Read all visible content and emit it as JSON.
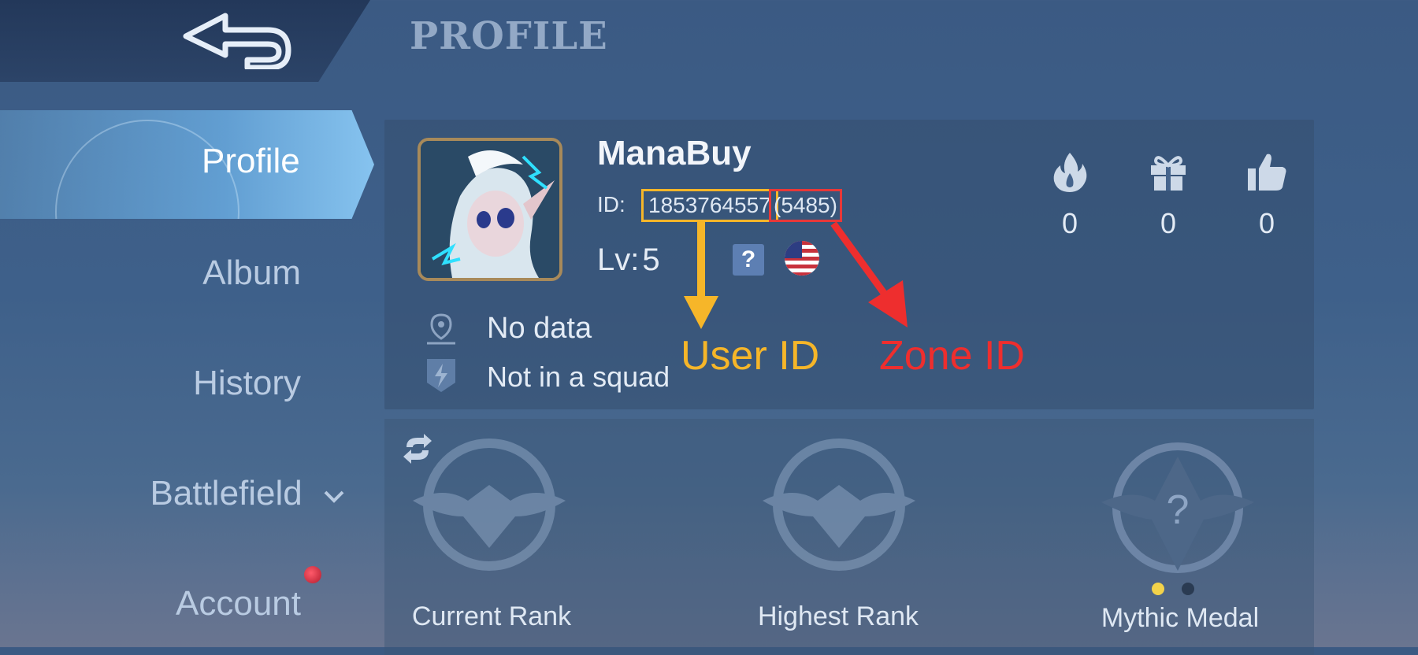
{
  "header": {
    "title": "PROFILE",
    "back_icon": "back-arrow-icon"
  },
  "sidebar": {
    "items": [
      {
        "label": "Profile",
        "active": true
      },
      {
        "label": "Album"
      },
      {
        "label": "History"
      },
      {
        "label": "Battlefield"
      },
      {
        "label": "Account",
        "has_notification": true
      }
    ]
  },
  "profile": {
    "username": "ManaBuy",
    "id_label": "ID:",
    "user_id": "1853764557",
    "zone_id": "(5485)",
    "level_label": "Lv:",
    "level": "5",
    "help_glyph": "?",
    "location": "No data",
    "squad": "Not in a squad"
  },
  "stats": [
    {
      "icon": "flame-icon",
      "value": "0"
    },
    {
      "icon": "gift-icon",
      "value": "0"
    },
    {
      "icon": "thumbs-up-icon",
      "value": "0"
    }
  ],
  "annotations": {
    "user_id": "User ID",
    "zone_id": "Zone ID",
    "user_color": "#f6b629",
    "zone_color": "#ee2e2e"
  },
  "ranks": [
    {
      "label": "Current Rank"
    },
    {
      "label": "Highest Rank"
    },
    {
      "label": "Mythic Medal",
      "glyph": "?"
    }
  ]
}
